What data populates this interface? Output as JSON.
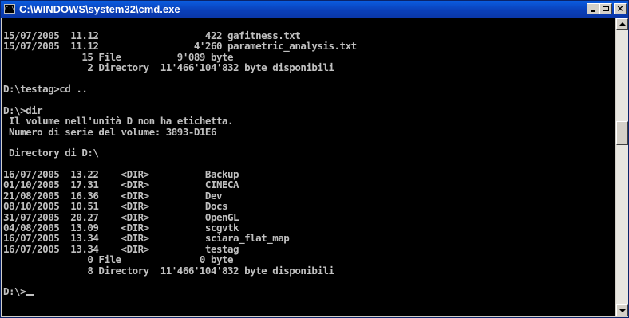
{
  "window": {
    "title": "C:\\WINDOWS\\system32\\cmd.exe",
    "icon_text": "C:\\",
    "icon": "console-icon"
  },
  "controls": {
    "minimize_icon": "minimize-icon",
    "maximize_icon": "maximize-icon",
    "close_label": "×"
  },
  "console": {
    "colors": {
      "background": "#000000",
      "text": "#c0c0c0",
      "title_bar": "#0a3fb8"
    },
    "lines": [
      "15/07/2005  11.12                   422 gafitness.txt",
      "15/07/2005  11.12                 4'260 parametric_analysis.txt",
      "              15 File          9'089 byte",
      "               2 Directory  11'466'104'832 byte disponibili",
      "",
      "D:\\testag>cd ..",
      "",
      "D:\\>dir",
      " Il volume nell'unità D non ha etichetta.",
      " Numero di serie del volume: 3893-D1E6",
      "",
      " Directory di D:\\",
      "",
      "16/07/2005  13.22    <DIR>          Backup",
      "01/10/2005  17.31    <DIR>          CINECA",
      "21/08/2005  16.36    <DIR>          Dev",
      "08/10/2005  10.51    <DIR>          Docs",
      "31/07/2005  20.27    <DIR>          OpenGL",
      "04/08/2005  13.09    <DIR>          scgvtk",
      "16/07/2005  13.34    <DIR>          sciara_flat_map",
      "16/07/2005  13.34    <DIR>          testag",
      "               0 File              0 byte",
      "               8 Directory  11'466'104'832 byte disponibili",
      "",
      "D:\\>"
    ]
  },
  "scrollbar": {
    "up_icon": "arrow-up-icon",
    "down_icon": "arrow-down-icon"
  }
}
